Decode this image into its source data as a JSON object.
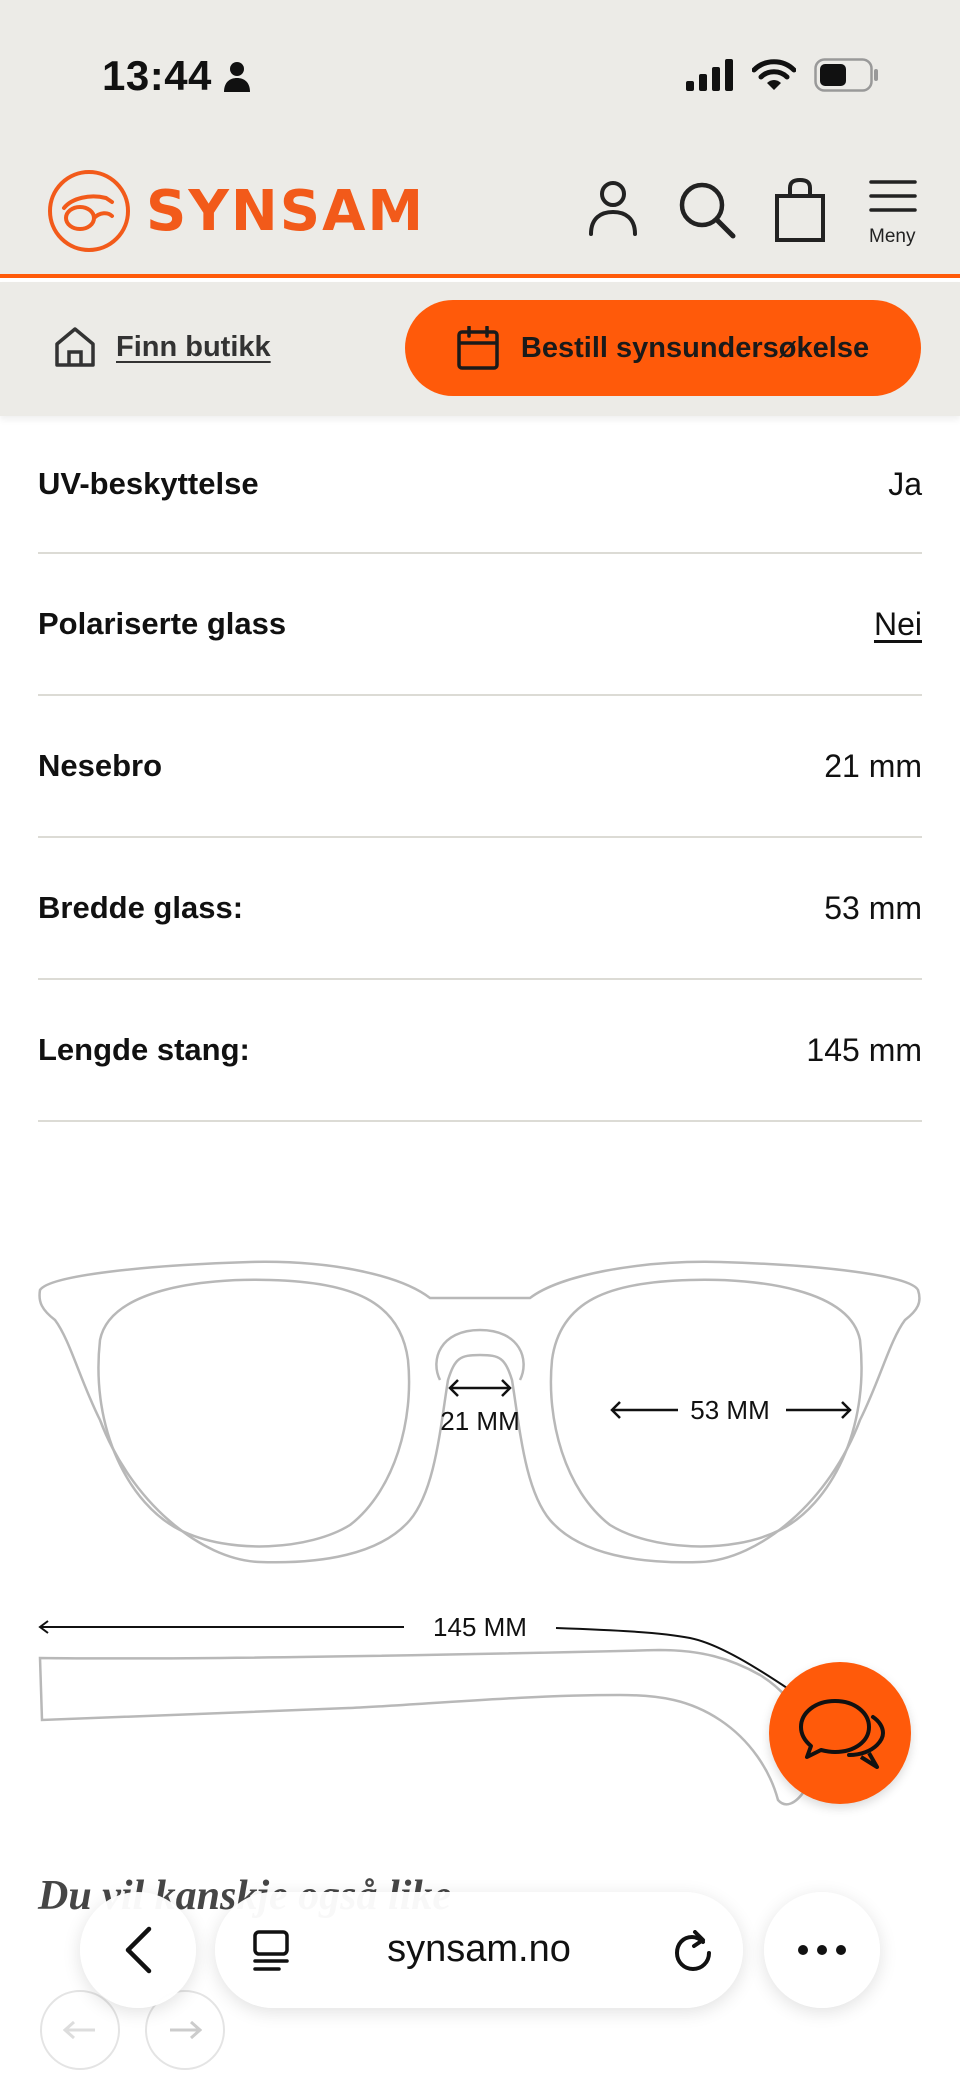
{
  "status_bar": {
    "time": "13:44"
  },
  "header": {
    "logo_text": "SYNSAM",
    "menu_label": "Meny",
    "accent_color": "#ff5a0a"
  },
  "subheader": {
    "find_store_label": "Finn butikk",
    "book_button_label": "Bestill synsundersøkelse"
  },
  "specs": [
    {
      "label": "UV-beskyttelse",
      "value": "Ja"
    },
    {
      "label": "Polariserte glass",
      "value": "Nei"
    },
    {
      "label": "Nesebro",
      "value": "21 mm"
    },
    {
      "label": "Bredde glass:",
      "value": "53 mm"
    },
    {
      "label": "Lengde stang:",
      "value": "145 mm"
    }
  ],
  "diagram": {
    "bridge_label": "21 MM",
    "lens_label": "53 MM",
    "temple_label": "145 MM"
  },
  "section_title": "Du vil kanskje også like",
  "browser": {
    "url": "synsam.no"
  },
  "icons": [
    "person-icon",
    "search-icon",
    "bag-icon",
    "menu-icon",
    "home-icon",
    "calendar-icon",
    "chat-icon",
    "back-icon",
    "tabs-icon",
    "reload-icon",
    "more-icon"
  ]
}
